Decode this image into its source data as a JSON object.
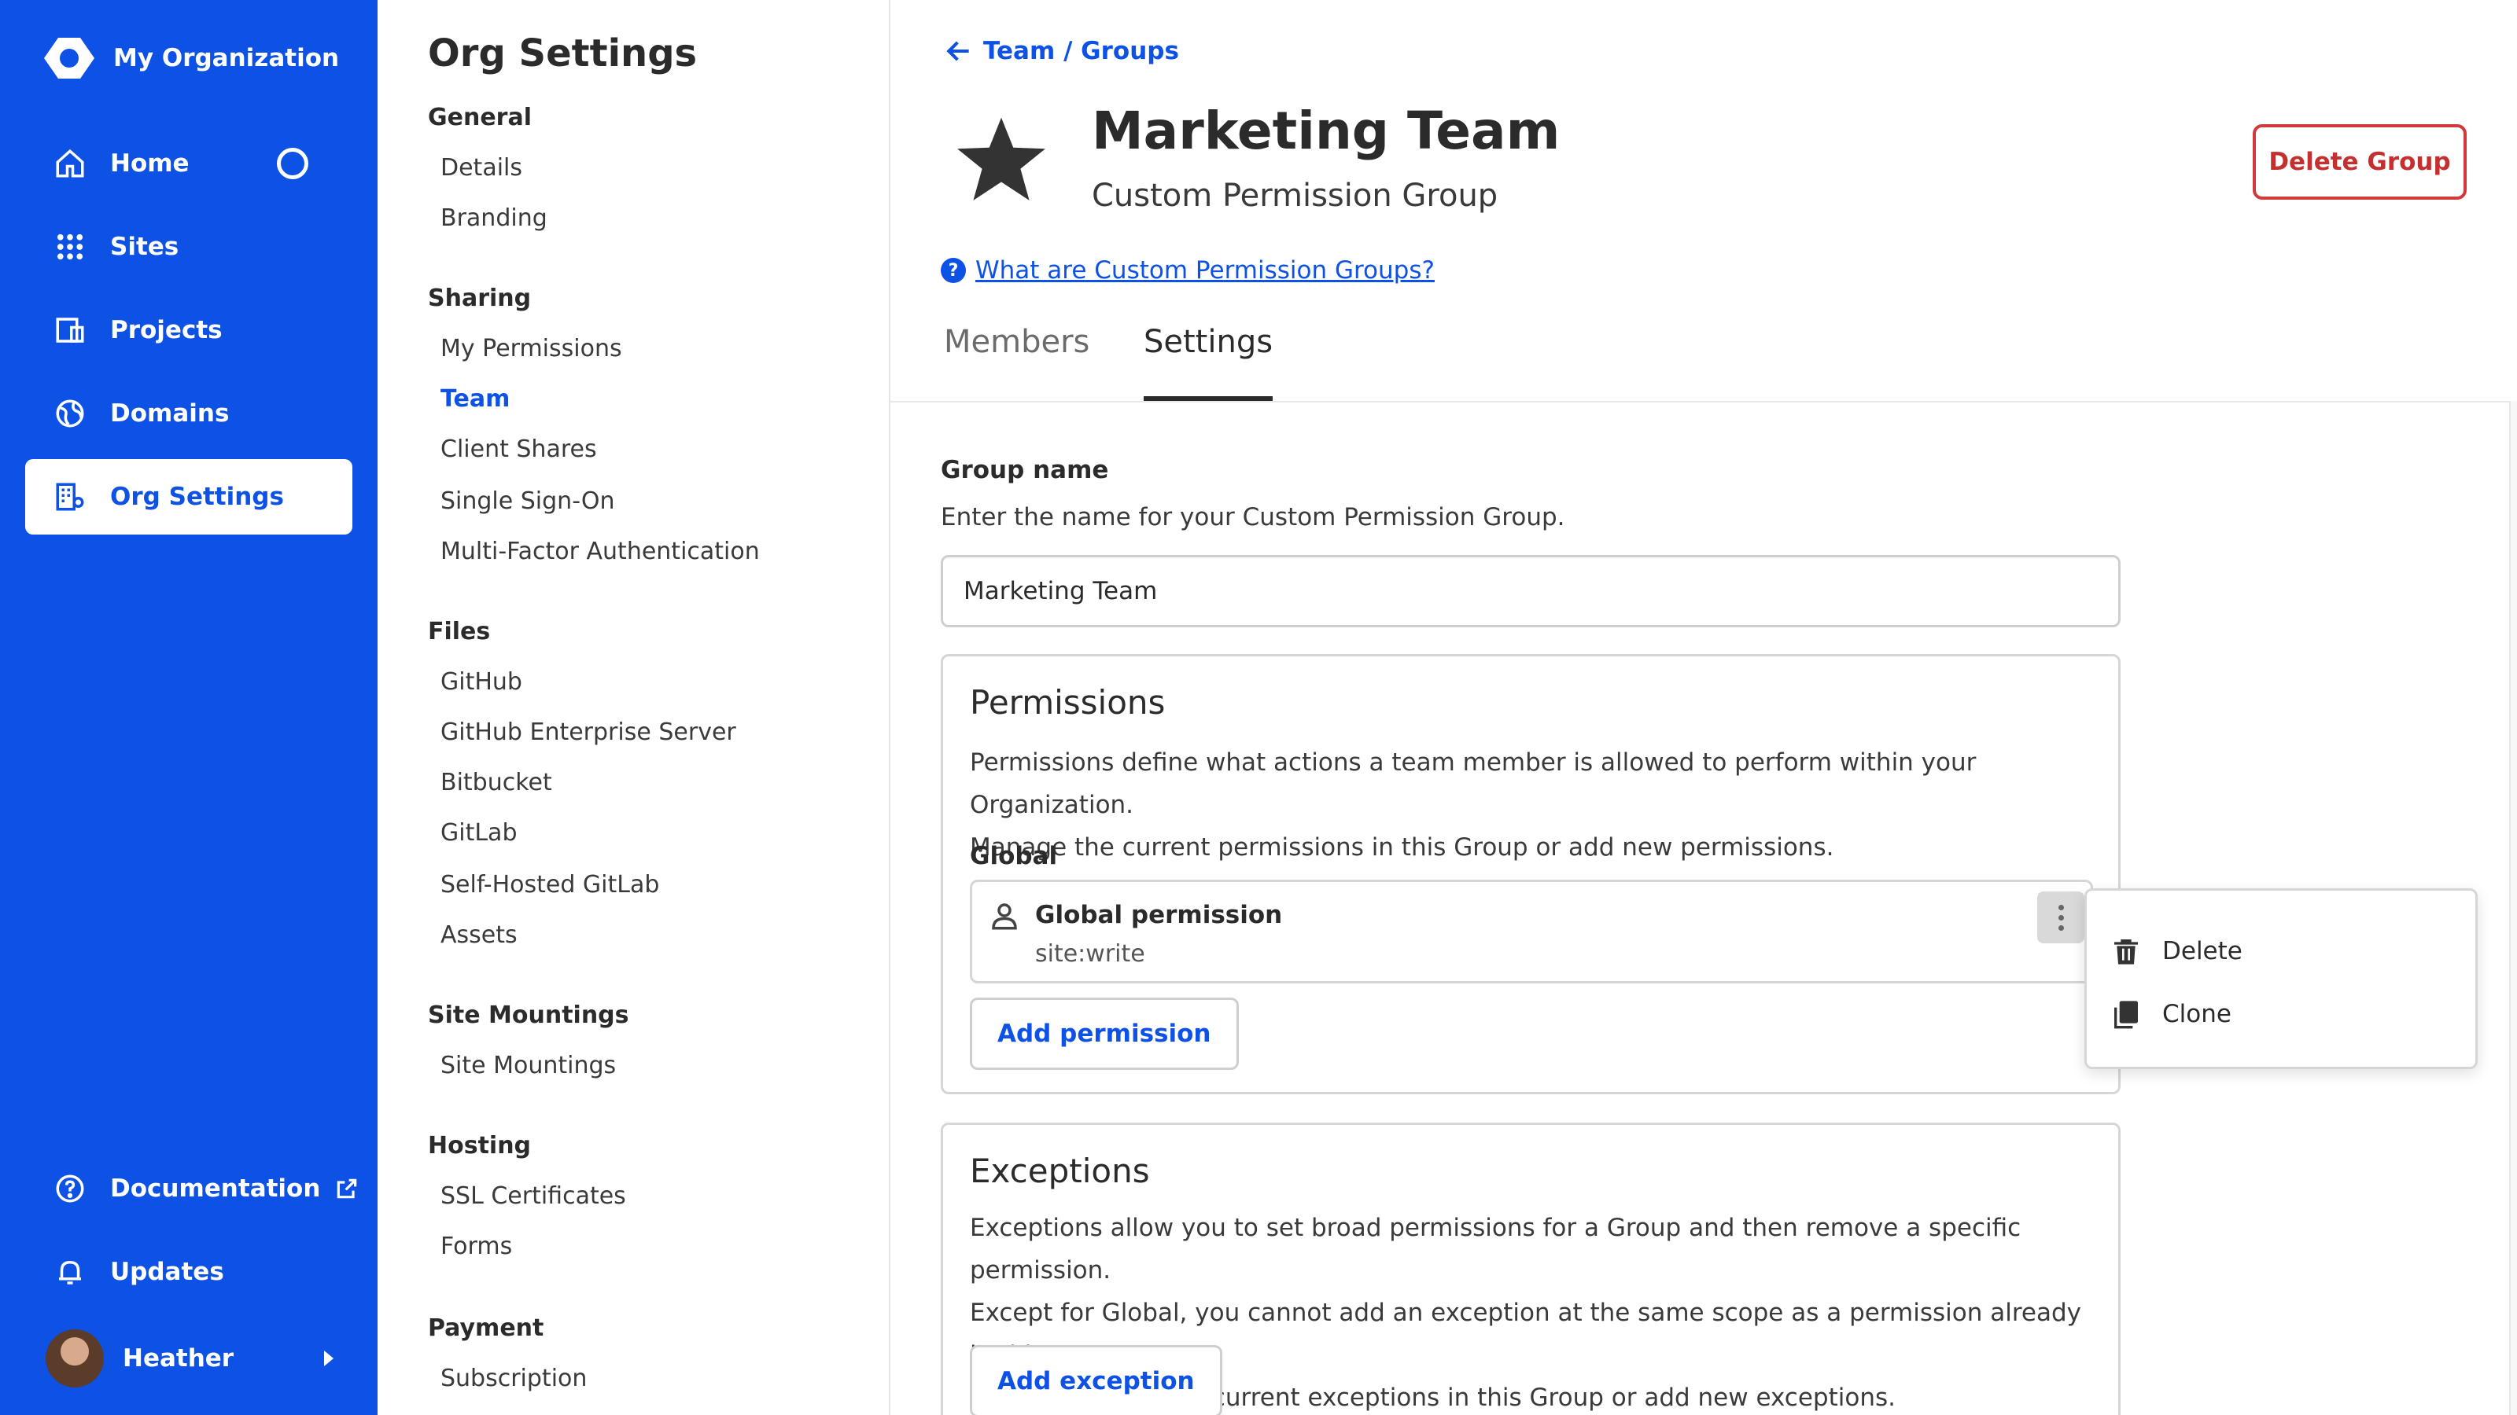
{
  "primary_nav": {
    "org_name": "My Organization",
    "items": [
      {
        "label": "Home",
        "icon": "home-icon"
      },
      {
        "label": "Sites",
        "icon": "grid-icon"
      },
      {
        "label": "Projects",
        "icon": "projects-icon"
      },
      {
        "label": "Domains",
        "icon": "globe-icon"
      },
      {
        "label": "Org Settings",
        "icon": "org-settings-icon",
        "active": true
      }
    ],
    "bottom": [
      {
        "label": "Documentation",
        "icon": "help-circle-icon"
      },
      {
        "label": "Updates",
        "icon": "bell-icon"
      }
    ],
    "user": {
      "name": "Heather"
    }
  },
  "secondary_nav": {
    "title": "Org Settings",
    "sections": [
      {
        "heading": "General",
        "links": [
          "Details",
          "Branding"
        ]
      },
      {
        "heading": "Sharing",
        "links": [
          "My Permissions",
          "Team",
          "Client Shares",
          "Single Sign-On",
          "Multi-Factor Authentication"
        ]
      },
      {
        "heading": "Files",
        "links": [
          "GitHub",
          "GitHub Enterprise Server",
          "Bitbucket",
          "GitLab",
          "Self-Hosted GitLab",
          "Assets"
        ]
      },
      {
        "heading": "Site Mountings",
        "links": [
          "Site Mountings"
        ]
      },
      {
        "heading": "Hosting",
        "links": [
          "SSL Certificates",
          "Forms"
        ]
      },
      {
        "heading": "Payment",
        "links": [
          "Subscription"
        ]
      }
    ],
    "active_link": "Team"
  },
  "main": {
    "breadcrumb": "Team / Groups",
    "group_title": "Marketing Team",
    "group_subtitle": "Custom Permission Group",
    "delete_button": "Delete Group",
    "help_link": "What are Custom Permission Groups?",
    "tabs": [
      {
        "label": "Members",
        "active": false
      },
      {
        "label": "Settings",
        "active": true
      }
    ],
    "group_name": {
      "label": "Group name",
      "help": "Enter the name for your Custom Permission Group.",
      "value": "Marketing Team"
    },
    "permissions": {
      "title": "Permissions",
      "desc_line1": "Permissions define what actions a team member is allowed to perform within your Organization.",
      "desc_line2": "Manage the current permissions in this Group or add new permissions.",
      "scope_label": "Global",
      "item": {
        "name": "Global permission",
        "scope": "site:write"
      },
      "add_button": "Add permission"
    },
    "exceptions": {
      "title": "Exceptions",
      "desc_line1": "Exceptions allow you to set broad permissions for a Group and then remove a specific permission.",
      "desc_line2": "Except for Global, you cannot add an exception at the same scope as a permission already in this",
      "desc_line3": "Group. Manage the current exceptions in this Group or add new exceptions.",
      "add_button": "Add exception"
    }
  },
  "context_menu": {
    "items": [
      {
        "label": "Delete",
        "icon": "trash-icon"
      },
      {
        "label": "Clone",
        "icon": "copy-icon"
      }
    ]
  },
  "colors": {
    "brand": "#0d51e5",
    "danger": "#c62f2f",
    "text": "#2b2b2b"
  }
}
